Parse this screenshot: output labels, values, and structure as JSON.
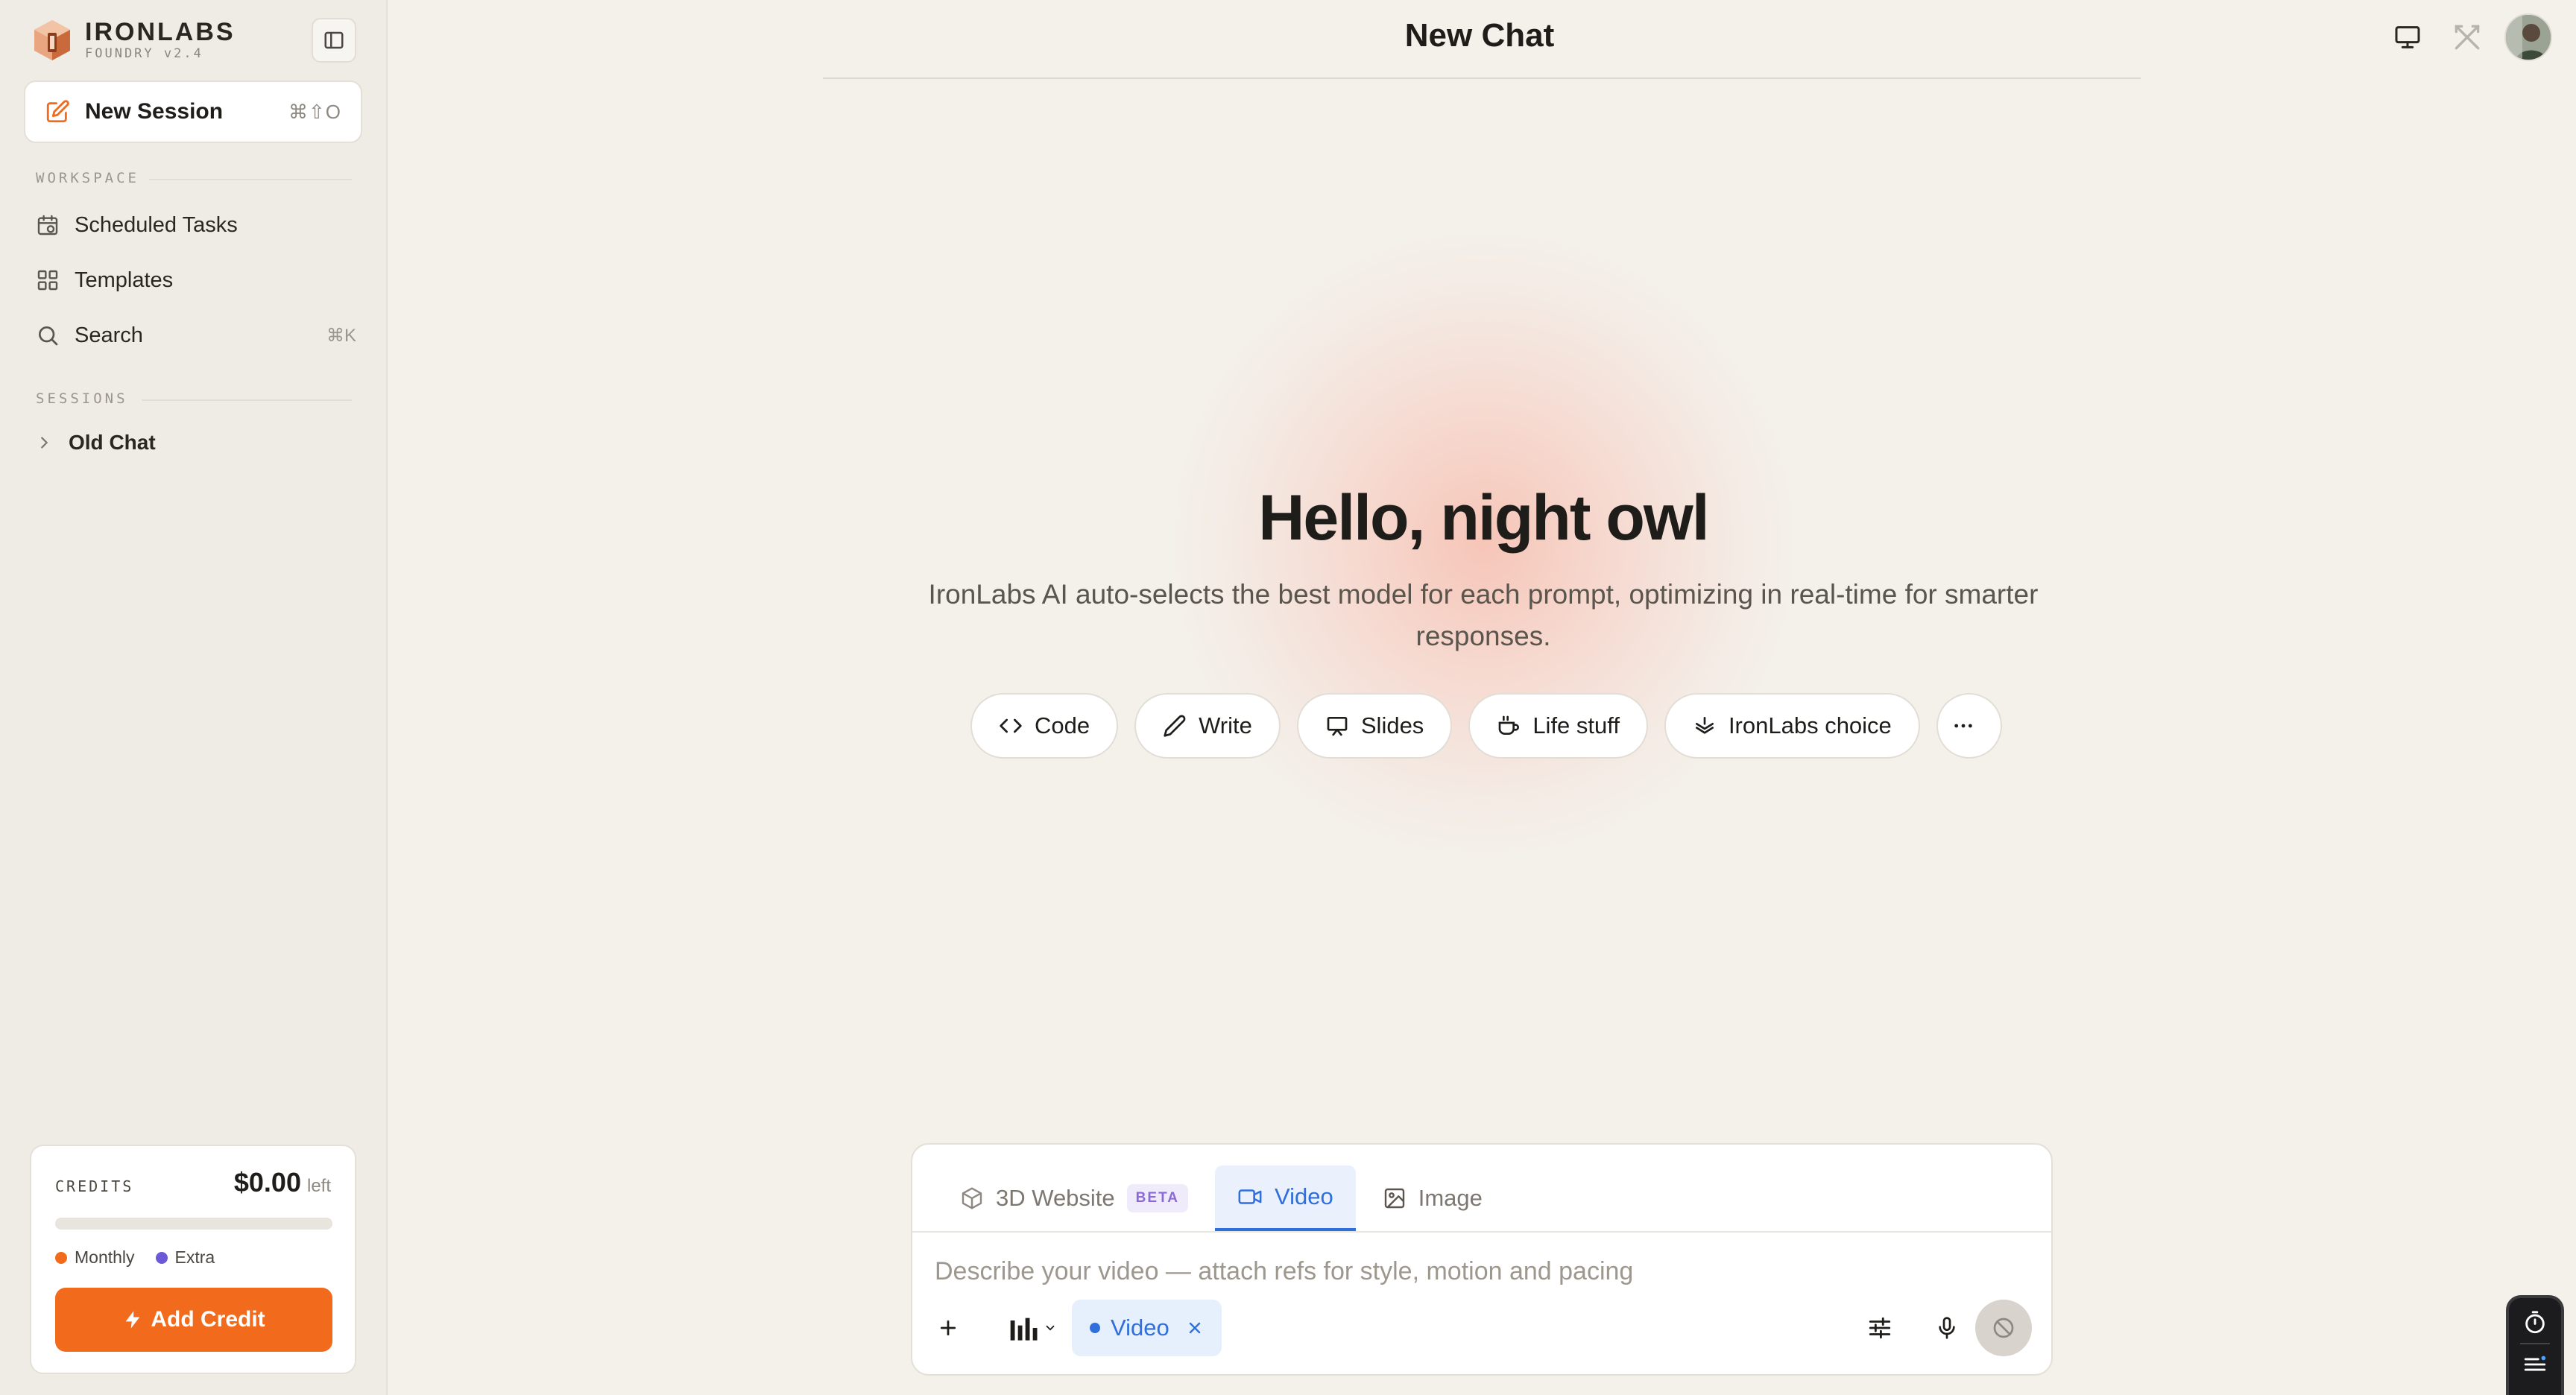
{
  "colors": {
    "accent": "#f26a1b",
    "blue": "#2f6fdb",
    "background": "#f4f1eb",
    "sidebar": "#efebe5",
    "extra_dot": "#6b5ad8"
  },
  "brand": {
    "name": "IRONLABS",
    "version": "FOUNDRY v2.4",
    "logo_icon": "hexagon-logo-icon"
  },
  "sidebar": {
    "new_session": {
      "label": "New Session",
      "shortcut": "⌘⇧O",
      "icon": "edit-icon"
    },
    "workspace_label": "WORKSPACE",
    "workspace_items": [
      {
        "label": "Scheduled Tasks",
        "icon": "calendar-clock-icon"
      },
      {
        "label": "Templates",
        "icon": "grid-icon"
      },
      {
        "label": "Search",
        "icon": "search-icon",
        "shortcut": "⌘K"
      }
    ],
    "sessions_label": "SESSIONS",
    "sessions": [
      {
        "label": "Old Chat",
        "icon": "chevron-right-icon"
      }
    ]
  },
  "credits": {
    "label": "CREDITS",
    "amount": "$0.00",
    "suffix": "left",
    "used_fraction": 0,
    "legend": [
      {
        "label": "Monthly",
        "color": "#f26a1b"
      },
      {
        "label": "Extra",
        "color": "#6b5ad8"
      }
    ],
    "add_label": "Add Credit"
  },
  "header": {
    "title": "New Chat"
  },
  "hero": {
    "title": "Hello, night owl",
    "subtitle_line1": "IronLabs AI auto-selects the best model for each prompt, optimizing in real-time for smarter",
    "subtitle_line2": "responses.",
    "chips": [
      {
        "label": "Code",
        "icon": "code-icon"
      },
      {
        "label": "Write",
        "icon": "pencil-icon"
      },
      {
        "label": "Slides",
        "icon": "presentation-icon"
      },
      {
        "label": "Life stuff",
        "icon": "coffee-cup-icon"
      },
      {
        "label": "IronLabs choice",
        "icon": "layers-icon"
      }
    ],
    "more_icon": "more-horizontal-icon"
  },
  "composer": {
    "tabs": [
      {
        "label": "3D Website",
        "badge": "BETA",
        "icon": "cube-icon",
        "active": false
      },
      {
        "label": "Video",
        "icon": "video-camera-icon",
        "active": true
      },
      {
        "label": "Image",
        "icon": "image-icon",
        "active": false
      }
    ],
    "placeholder": "Describe your video — attach refs for style, motion and pacing",
    "value": "",
    "mode_pill": "Video"
  }
}
